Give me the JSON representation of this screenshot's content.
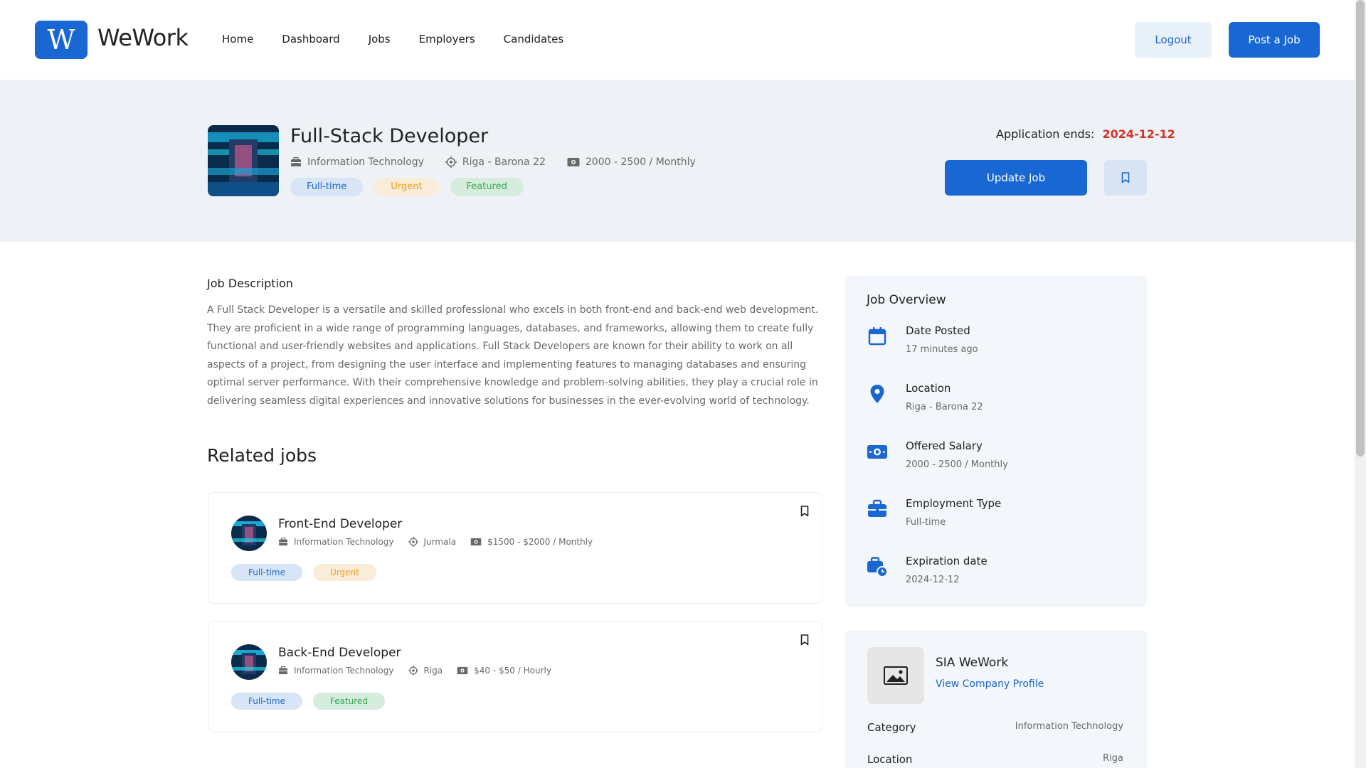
{
  "brand": {
    "logo_letter": "W",
    "name": "WeWork",
    "accent": "#1967d2"
  },
  "nav": [
    "Home",
    "Dashboard",
    "Jobs",
    "Employers",
    "Candidates"
  ],
  "header_actions": {
    "logout": "Logout",
    "post_job": "Post a Job"
  },
  "job": {
    "title": "Full-Stack Developer",
    "category": "Information Technology",
    "location": "Riga - Barona 22",
    "salary": "2000 - 2500 / Monthly",
    "tags": [
      "Full-time",
      "Urgent",
      "Featured"
    ],
    "application_ends_label": "Application ends:",
    "application_ends_date": "2024-12-12",
    "update_button": "Update Job"
  },
  "description": {
    "title": "Job Description",
    "text": "A Full Stack Developer is a versatile and skilled professional who excels in both front-end and back-end web development. They are proficient in a wide range of programming languages, databases, and frameworks, allowing them to create fully functional and user-friendly websites and applications. Full Stack Developers are known for their ability to work on all aspects of a project, from designing the user interface and implementing features to managing databases and ensuring optimal server performance. With their comprehensive knowledge and problem-solving abilities, they play a crucial role in delivering seamless digital experiences and innovative solutions for businesses in the ever-evolving world of technology."
  },
  "related": {
    "title": "Related jobs",
    "jobs": [
      {
        "title": "Front-End Developer",
        "category": "Information Technology",
        "location": "Jurmala",
        "salary": "$1500 - $2000 / Monthly",
        "tags": [
          "Full-time",
          "Urgent"
        ]
      },
      {
        "title": "Back-End Developer",
        "category": "Information Technology",
        "location": "Riga",
        "salary": "$40 - $50 / Hourly",
        "tags": [
          "Full-time",
          "Featured"
        ]
      }
    ]
  },
  "overview": {
    "title": "Job Overview",
    "items": [
      {
        "label": "Date Posted",
        "value": "17 minutes ago",
        "icon": "calendar-icon"
      },
      {
        "label": "Location",
        "value": "Riga - Barona 22",
        "icon": "location-pin-icon"
      },
      {
        "label": "Offered Salary",
        "value": "2000 - 2500 / Monthly",
        "icon": "money-icon"
      },
      {
        "label": "Employment Type",
        "value": "Full-time",
        "icon": "briefcase-icon"
      },
      {
        "label": "Expiration date",
        "value": "2024-12-12",
        "icon": "briefcase-clock-icon"
      }
    ]
  },
  "company": {
    "name": "SIA WeWork",
    "profile_link": "View Company Profile",
    "category_label": "Category",
    "category_value": "Information Technology",
    "location_label": "Location",
    "location_value": "Riga"
  }
}
